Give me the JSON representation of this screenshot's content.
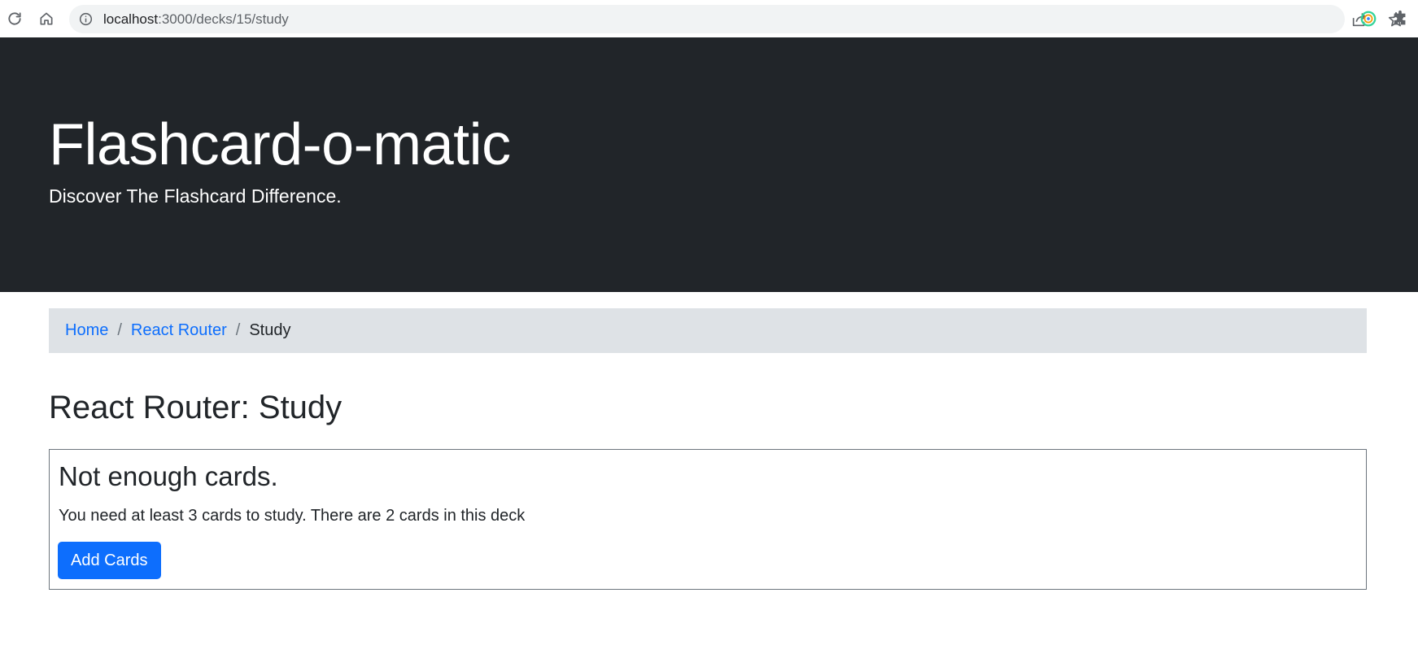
{
  "browser": {
    "url_host": "localhost",
    "url_path": ":3000/decks/15/study"
  },
  "header": {
    "title": "Flashcard-o-matic",
    "subtitle": "Discover The Flashcard Difference."
  },
  "breadcrumb": {
    "items": [
      {
        "label": "Home"
      },
      {
        "label": "React Router"
      },
      {
        "label": "Study"
      }
    ],
    "separator": "/"
  },
  "page": {
    "title": "React Router: Study"
  },
  "card": {
    "heading": "Not enough cards.",
    "text": "You need at least 3 cards to study. There are 2 cards in this deck",
    "button_label": "Add Cards"
  },
  "colors": {
    "header_bg": "#212529",
    "breadcrumb_bg": "#dee2e6",
    "link": "#0d6efd",
    "primary_button": "#0d6efd"
  }
}
